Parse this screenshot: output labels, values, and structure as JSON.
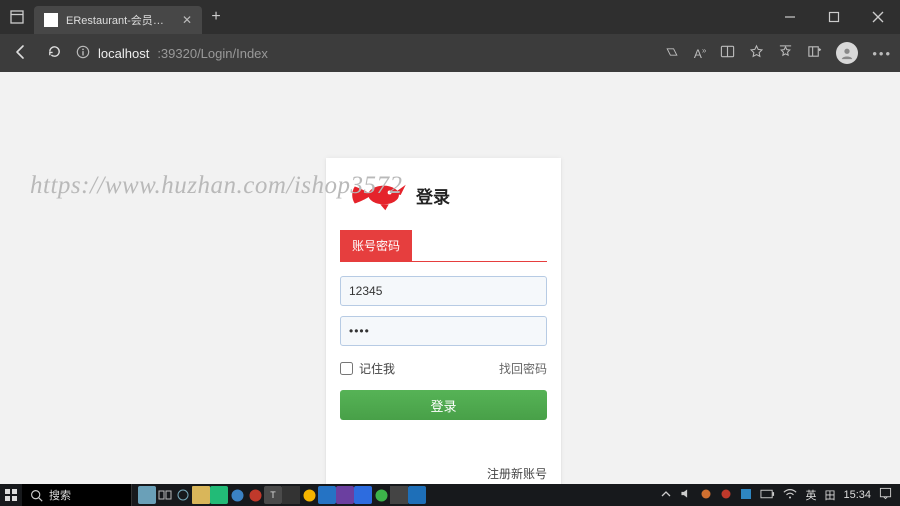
{
  "browser": {
    "tab_title": "ERestaurant-会员中心",
    "url_host": "localhost",
    "url_port_path": ":39320/Login/Index"
  },
  "watermark": "https://www.huzhan.com/ishop3572",
  "login": {
    "title": "登录",
    "tab_label": "账号密码",
    "username_value": "12345",
    "password_value": "••••",
    "remember_label": "记住我",
    "forgot_label": "找回密码",
    "button_label": "登录",
    "register_label": "注册新账号"
  },
  "taskbar": {
    "search_label": "搜索",
    "ime_lang": "英",
    "ime_mode": "田",
    "clock": "15:34"
  }
}
